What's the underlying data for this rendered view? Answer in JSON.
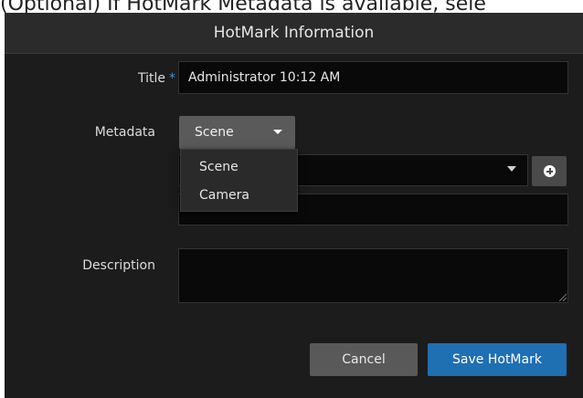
{
  "caption": "(Optional) If HotMark Metadata is available, sele",
  "dialog": {
    "title": "HotMark Information"
  },
  "form": {
    "title_label": "Title",
    "required_marker": "*",
    "title_value": "Administrator 10:12 AM",
    "metadata_label": "Metadata",
    "metadata_selected": "Scene",
    "metadata_options": [
      "Scene",
      "Camera"
    ],
    "description_label": "Description",
    "description_value": ""
  },
  "buttons": {
    "cancel": "Cancel",
    "save": "Save HotMark"
  },
  "icons": {
    "add": "plus-circle-icon",
    "dropdown": "caret-down-icon"
  },
  "colors": {
    "dialog_bg": "#1c1c1c",
    "header_bg": "#2b2b2b",
    "primary": "#1f6fb3",
    "required": "#3f8fd6"
  }
}
